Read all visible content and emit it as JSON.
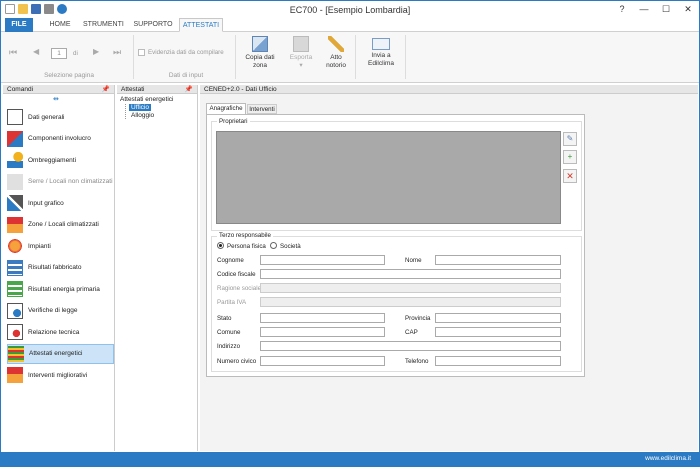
{
  "window": {
    "title": "EC700 - [Esempio Lombardia]"
  },
  "tabs": {
    "file": "FILE",
    "home": "HOME",
    "strumenti": "STRUMENTI",
    "supporto": "SUPPORTO",
    "attestati": "ATTESTATI"
  },
  "ribbon": {
    "page_value": "1",
    "page_of": "di",
    "evidenzia": "Evidenzia dati da compilare",
    "group_selezione": "Selezione pagina",
    "group_input": "Dati di input",
    "copia": "Copia dati zona",
    "esporta": "Esporta",
    "atto": "Atto notorio",
    "invia": "Invia a Edilclima"
  },
  "comandi": {
    "title": "Comandi",
    "items": [
      {
        "label": "Dati generali"
      },
      {
        "label": "Componenti involucro"
      },
      {
        "label": "Ombreggiamenti"
      },
      {
        "label": "Serre / Locali non climatizzati"
      },
      {
        "label": "Input grafico"
      },
      {
        "label": "Zone / Locali climatizzati"
      },
      {
        "label": "Impianti"
      },
      {
        "label": "Risultati fabbricato"
      },
      {
        "label": "Risultati energia primaria"
      },
      {
        "label": "Verifiche di legge"
      },
      {
        "label": "Relazione tecnica"
      },
      {
        "label": "Attestati energetici"
      },
      {
        "label": "Interventi migliorativi"
      }
    ]
  },
  "attestati_panel": {
    "title": "Attestati",
    "root": "Attestati energetici",
    "child1": "Ufficio",
    "child2": "Alloggio"
  },
  "main": {
    "title": "CENED+2.0 - Dati Ufficio",
    "tab_anagrafiche": "Anagrafiche",
    "tab_interventi": "Interventi",
    "proprietari": "Proprietari",
    "terzo": "Terzo responsabile",
    "persona_fisica": "Persona fisica",
    "societa": "Società",
    "cognome": "Cognome",
    "nome": "Nome",
    "codice_fiscale": "Codice fiscale",
    "ragione_sociale": "Ragione sociale",
    "partita_iva": "Partita IVA",
    "stato": "Stato",
    "provincia": "Provincia",
    "comune": "Comune",
    "cap": "CAP",
    "indirizzo": "Indirizzo",
    "numero_civico": "Numero civico",
    "telefono": "Telefono"
  },
  "status": {
    "url": "www.edilclima.it"
  },
  "colors": {
    "accent": "#2b7bc4",
    "selection": "#cde4f8",
    "grid_gray": "#a9a9a9"
  }
}
